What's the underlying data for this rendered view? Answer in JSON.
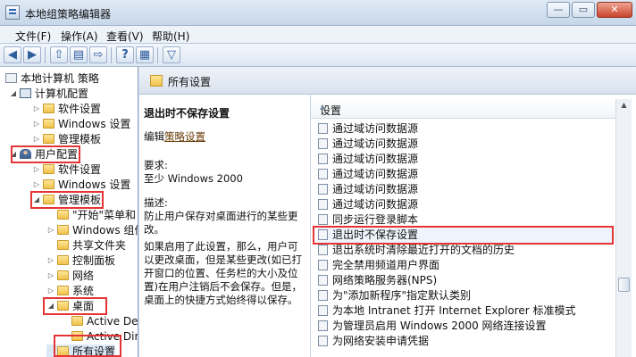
{
  "window": {
    "title": "本地组策略编辑器",
    "minimize": "—",
    "restore": "▭",
    "close": "✕"
  },
  "menu": [
    "文件(F)",
    "操作(A)",
    "查看(V)",
    "帮助(H)"
  ],
  "tree": {
    "root": "本地计算机 策略",
    "computer_config": "计算机配置",
    "software_settings_1": "软件设置",
    "windows_settings_1": "Windows 设置",
    "admin_templates_1": "管理模板",
    "user_config": "用户配置",
    "software_settings_2": "软件设置",
    "windows_settings_2": "Windows 设置",
    "admin_templates_2": "管理模板",
    "start_menu": "\"开始\"菜单和",
    "windows_components": "Windows 组件",
    "shared_folders": "共享文件夹",
    "control_panel": "控制面板",
    "network": "网络",
    "system": "系统",
    "desktop": "桌面",
    "active_desktop": "Active Des",
    "active_directory": "Active Dir",
    "all_settings": "所有设置"
  },
  "content": {
    "header": "所有设置",
    "desc_title": "退出时不保存设置",
    "edit_prefix": "编辑",
    "policy_link": "策略设置",
    "req_label": "要求:",
    "req_value": "至少 Windows 2000",
    "desc_label": "描述:",
    "desc_value": "防止用户保存对桌面进行的某些更改。",
    "desc_detail": "如果启用了此设置，那么，用户可以更改桌面，但是某些更改(如已打开窗口的位置、任务栏的大小及位置)在用户注销后不会保存。但是，桌面上的快捷方式始终得以保存。",
    "column_header": "设置",
    "rows": [
      "通过域访问数据源",
      "通过域访问数据源",
      "通过域访问数据源",
      "通过域访问数据源",
      "通过域访问数据源",
      "通过域访问数据源",
      "同步运行登录脚本",
      "退出时不保存设置",
      "退出系统时清除最近打开的文档的历史",
      "完全禁用频道用户界面",
      "网络策略服务器(NPS)",
      "为\"添加新程序\"指定默认类别",
      "为本地 Intranet 打开 Internet Explorer 标准模式",
      "为管理员启用 Windows 2000 网络连接设置",
      "为网络安装申请凭据"
    ]
  }
}
